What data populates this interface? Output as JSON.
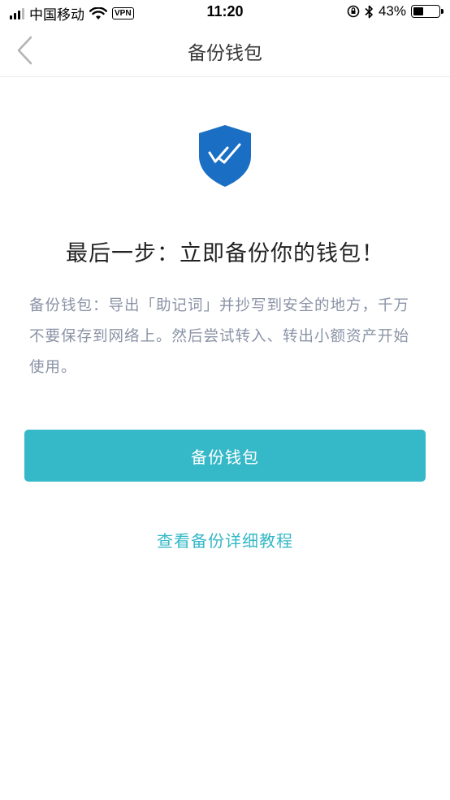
{
  "status_bar": {
    "carrier": "中国移动",
    "vpn_label": "VPN",
    "time": "11:20",
    "battery_percent": "43%",
    "battery_level": 0.43
  },
  "nav": {
    "title": "备份钱包"
  },
  "main": {
    "headline": "最后一步：立即备份你的钱包！",
    "description": "备份钱包：导出「助记词」并抄写到安全的地方，千万不要保存到网络上。然后尝试转入、转出小额资产开始使用。",
    "backup_button_label": "备份钱包",
    "tutorial_link_label": "查看备份详细教程"
  },
  "colors": {
    "accent": "#35b8c7",
    "shield_blue": "#1a6fc4",
    "description_text": "#8a93a6"
  },
  "icons": {
    "back": "chevron-left-icon",
    "shield": "shield-check-icon"
  }
}
